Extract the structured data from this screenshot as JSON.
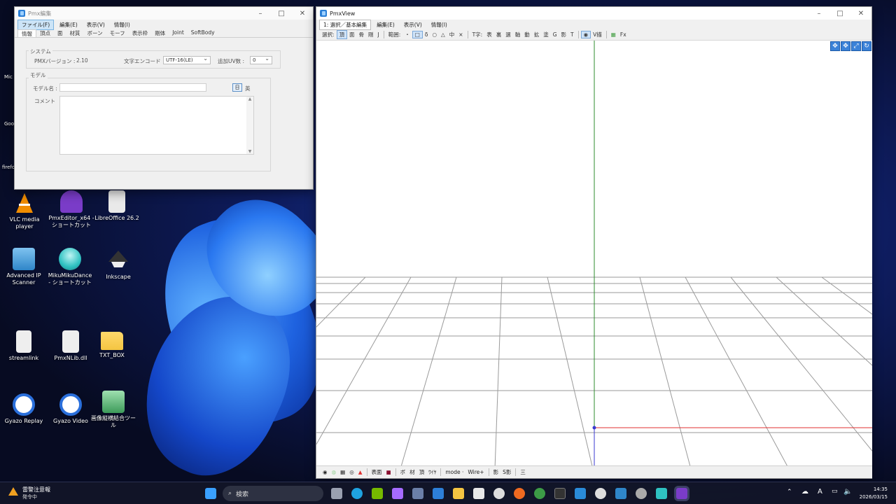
{
  "desktop": {
    "icons": [
      {
        "label": "VLC media player",
        "icon": "vlc-icon",
        "color": "#f08c00"
      },
      {
        "label": "PmxEditor_x64 - ショートカット",
        "icon": "pmxeditor-icon",
        "color": "#7a3cc8"
      },
      {
        "label": "LibreOffice 26.2",
        "icon": "libreoffice-icon",
        "color": "#e9e9e9"
      },
      {
        "label": "Advanced IP Scanner",
        "icon": "network-scanner-icon",
        "color": "#4aa3df"
      },
      {
        "label": "MikuMikuDance - ショートカット",
        "icon": "mmd-icon",
        "color": "#2fc1c1"
      },
      {
        "label": "Inkscape",
        "icon": "inkscape-icon",
        "color": "#333333"
      },
      {
        "label": "streamlink",
        "icon": "file-icon",
        "color": "#eeeeee"
      },
      {
        "label": "PmxNLib.dll",
        "icon": "dll-file-icon",
        "color": "#eeeeee"
      },
      {
        "label": "TXT_BOX",
        "icon": "folder-icon",
        "color": "#f4c542"
      },
      {
        "label": "Gyazo Replay",
        "icon": "gyazo-replay-icon",
        "color": "#2a6fdb"
      },
      {
        "label": "Gyazo Video",
        "icon": "gyazo-video-icon",
        "color": "#2a6fdb"
      },
      {
        "label": "画像縦横結合ツール",
        "icon": "image-tool-icon",
        "color": "#3d9b5a"
      }
    ],
    "edge_labels": [
      "Mic",
      "Goo",
      "firefo"
    ]
  },
  "editor": {
    "title": "Pmx編集",
    "menu": [
      "ファイル(F)",
      "編集(E)",
      "表示(V)",
      "情報(I)"
    ],
    "tabs": [
      "情報",
      "頂点",
      "面",
      "材質",
      "ボーン",
      "モーフ",
      "表示枠",
      "剛体",
      "Joint",
      "SoftBody"
    ],
    "system_group": "システム",
    "pmx_version_label": "PMXバージョン :",
    "pmx_version_value": "2.10",
    "encoding_label": "文字エンコード",
    "encoding_value": "UTF-16(LE)",
    "additional_uv_label": "追加UV数 :",
    "additional_uv_value": "0",
    "model_group": "モデル",
    "model_name_label": "モデル名 :",
    "comment_label": "コメント",
    "lang_jp": "日",
    "lang_en": "英"
  },
  "view": {
    "title": "PmxView",
    "mode_select": "1: 選択／基本編集",
    "menu": [
      "編集(E)",
      "表示(V)",
      "情報(I)"
    ],
    "toolbar": {
      "select_label": "選択:",
      "select_items": [
        "頂",
        "面",
        "骨",
        "剛",
        "J"
      ],
      "range_label": "範囲:",
      "range_items": [
        "・",
        "□",
        "δ",
        "○",
        "△",
        "中",
        "×"
      ],
      "axis_label": "T字:",
      "axis_items": [
        "表",
        "裏",
        "選",
        "軸",
        "動",
        "拡",
        "塗",
        "G",
        "影",
        "T"
      ],
      "vdraw": "V描",
      "fx": "Fx"
    },
    "bottombar": [
      "表面",
      "ボ",
      "材",
      "頂",
      "ﾜｲﾔ",
      "mode ·",
      "Wire+",
      "影",
      "S影",
      "三"
    ]
  },
  "taskbar": {
    "weather_title": "雷警注意報",
    "weather_sub": "発令中",
    "search_placeholder": "検索",
    "clock_time": "14:35",
    "clock_date": "2026/03/15"
  },
  "colors": {
    "accent": "#0b5cad",
    "grid": "#9a9a9a",
    "axis_green": "#2e8b2e",
    "axis_red": "#e23030"
  }
}
